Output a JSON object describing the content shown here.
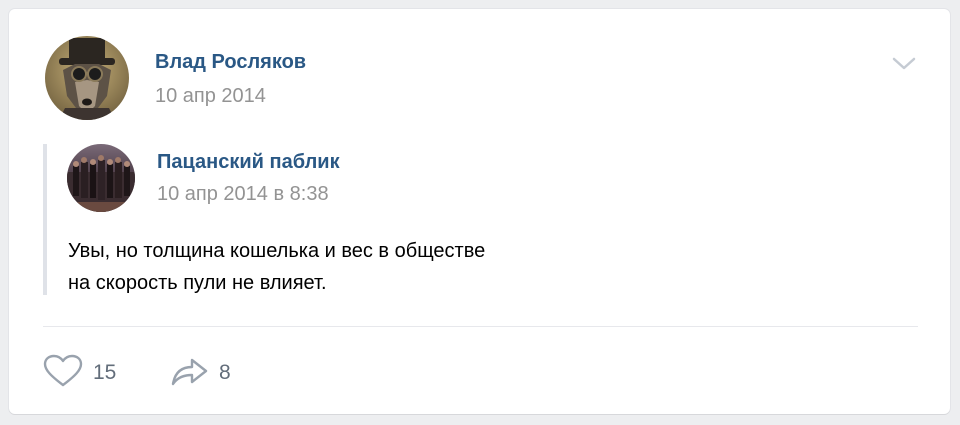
{
  "post": {
    "author_name": "Влад Росляков",
    "date": "10 апр 2014",
    "menu_icon": "chevron-down-icon"
  },
  "repost": {
    "source_name": "Пацанский паблик",
    "date": "10 апр 2014 в 8:38",
    "text_lines": [
      "Увы, но толщина кошелька и вес в обществе",
      "на скорость пули не влияет."
    ]
  },
  "actions": {
    "likes_count": "15",
    "shares_count": "8",
    "like_icon": "heart-icon",
    "share_icon": "share-arrow-icon"
  },
  "colors": {
    "link": "#2a5885",
    "meta": "#939393",
    "icon": "#99a2ad",
    "divider": "#e7e8ec",
    "background": "#edeef0"
  }
}
